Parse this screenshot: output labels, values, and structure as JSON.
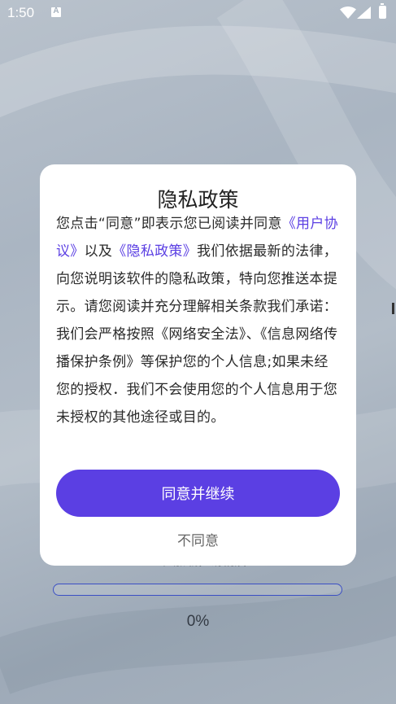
{
  "status_bar": {
    "time": "1:50",
    "notification_icon_letter": "A",
    "icons": [
      "wifi-icon",
      "signal-icon",
      "battery-charging-icon"
    ]
  },
  "loading": {
    "text": "正在加载，请稍后",
    "progress_percent": 0,
    "progress_label": "0%"
  },
  "dialog": {
    "title": "隐私政策",
    "body": {
      "p1_before": "您点击“同意”即表示您已阅读并同意",
      "user_agreement_link": "《用户协议》",
      "p1_mid": "以及",
      "privacy_policy_link": "《隐私政策》",
      "p1_after": "我们依据最新的法律，向您说明该软件的隐私政策，特向您推送本提示。请您阅读并充分理解相关条款我们承诺：",
      "p2": "我们会严格按照《网络安全法》、《信息网络传播保护条例》等保护您的个人信息;如果未经您的授权．我们不会使用您的个人信息用于您未授权的其他途径或目的。"
    },
    "agree_button": "同意并继续",
    "disagree_button": "不同意"
  },
  "colors": {
    "accent": "#5b3fe3",
    "progress_border": "#3b4fc4",
    "dialog_bg": "#ffffff"
  }
}
